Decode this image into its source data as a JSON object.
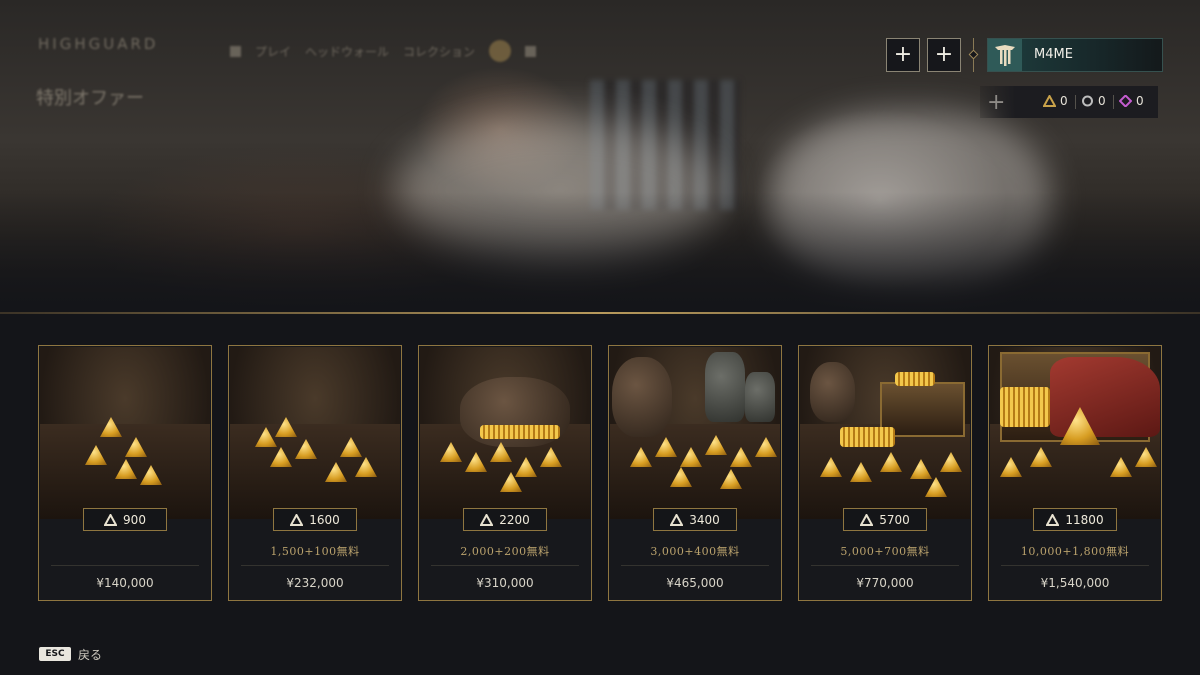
{
  "header": {
    "logo": "HIGHGUARD",
    "nav": [
      "プレイ",
      "ヘッドウォール",
      "コレクション"
    ],
    "page_title": "特別オファー"
  },
  "topbar": {
    "plus_icon": "plus-icon",
    "username": "M4ME",
    "currencies": [
      {
        "icon": "crystal-currency-icon",
        "value": "0",
        "color": "#c9a24a"
      },
      {
        "icon": "silver-currency-icon",
        "value": "0",
        "color": "#bdbdbd"
      },
      {
        "icon": "gem-currency-icon",
        "value": "0",
        "color": "#c45ccf"
      }
    ]
  },
  "offers": [
    {
      "amount": "900",
      "bonus": "",
      "price": "¥140,000"
    },
    {
      "amount": "1600",
      "bonus": "1,500+100無料",
      "price": "¥232,000"
    },
    {
      "amount": "2200",
      "bonus": "2,000+200無料",
      "price": "¥310,000"
    },
    {
      "amount": "3400",
      "bonus": "3,000+400無料",
      "price": "¥465,000"
    },
    {
      "amount": "5700",
      "bonus": "5,000+700無料",
      "price": "¥770,000"
    },
    {
      "amount": "11800",
      "bonus": "10,000+1,800無料",
      "price": "¥1,540,000"
    }
  ],
  "footer": {
    "esc_key": "ESC",
    "back_label": "戻る"
  }
}
